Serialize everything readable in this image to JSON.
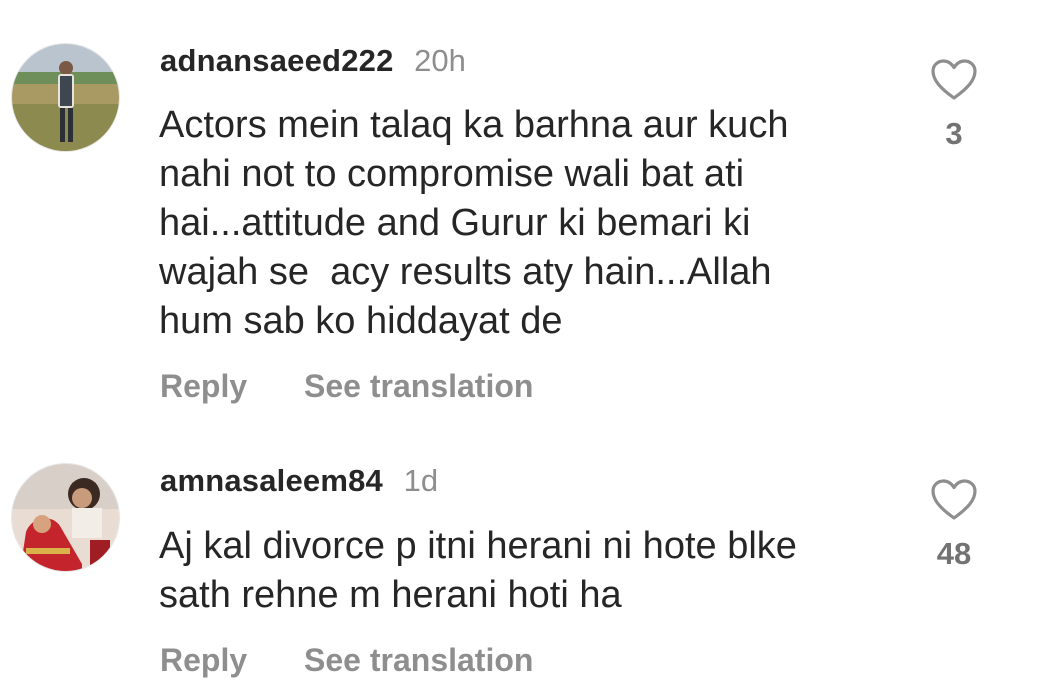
{
  "comments": [
    {
      "username": "adnansaeed222",
      "time": "20h",
      "text_lines": [
        "Actors mein talaq ka barhna aur kuch",
        "nahi not to compromise wali bat ati",
        "hai...attitude and Gurur ki bemari ki",
        "wajah se  acy results aty hain...Allah",
        "hum sab ko hiddayat de"
      ],
      "reply_label": "Reply",
      "translate_label": "See translation",
      "like_count": "3",
      "like_icon": "heart-outline-icon"
    },
    {
      "username": "amnasaleem84",
      "time": "1d",
      "text_lines": [
        "Aj kal divorce p itni herani ni hote blke",
        "sath rehne m herani hoti ha"
      ],
      "reply_label": "Reply",
      "translate_label": "See translation",
      "like_count": "48",
      "like_icon": "heart-outline-icon"
    }
  ],
  "colors": {
    "primary_text": "#262626",
    "secondary_text": "#8e8e8e",
    "background": "#ffffff"
  }
}
